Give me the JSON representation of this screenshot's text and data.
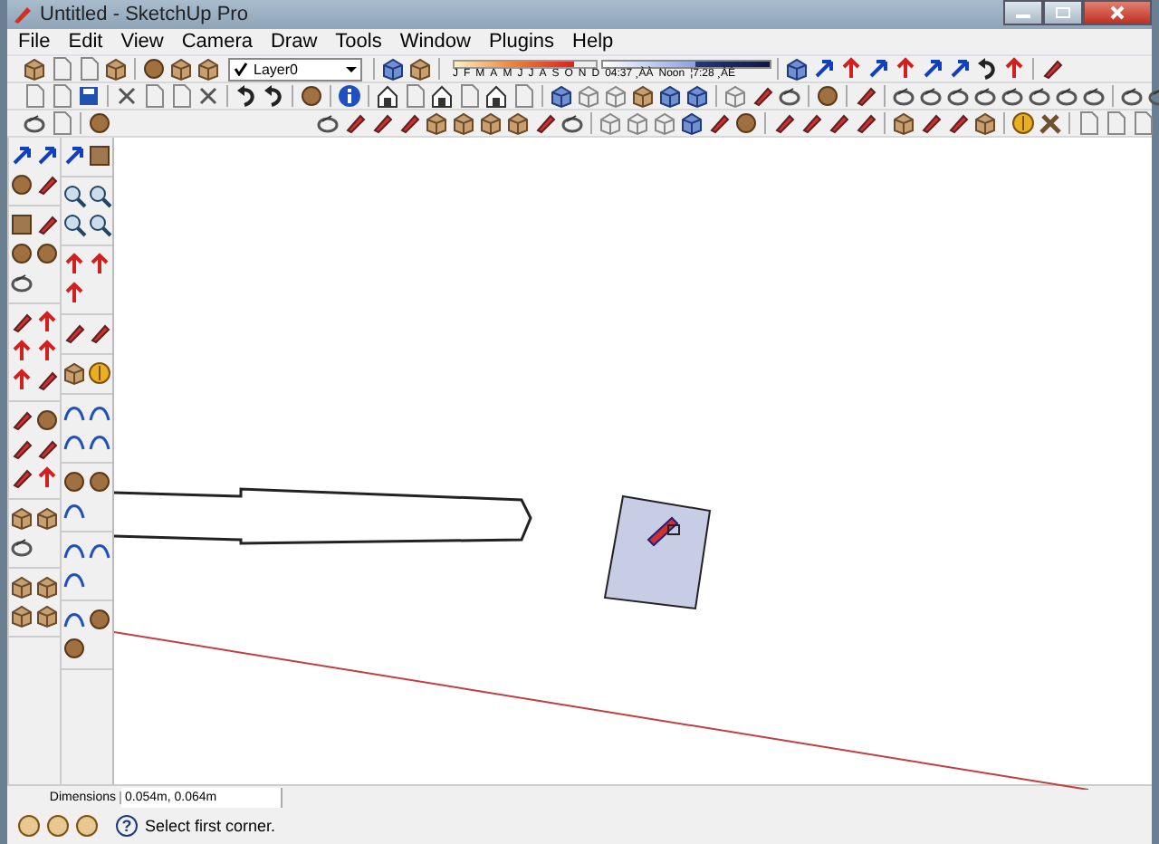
{
  "window": {
    "title": "Untitled - SketchUp Pro"
  },
  "menu": [
    "File",
    "Edit",
    "View",
    "Camera",
    "Draw",
    "Tools",
    "Window",
    "Plugins",
    "Help"
  ],
  "layers": {
    "value": "Layer0",
    "checked": true
  },
  "shadows": {
    "date_slider": {
      "level": 0.85
    },
    "time_slider": {
      "level": 0.55
    },
    "months": [
      "J",
      "F",
      "M",
      "A",
      "M",
      "J",
      "J",
      "A",
      "S",
      "O",
      "N",
      "D"
    ],
    "start_time": "04:37 ¸ÀÀ",
    "noon": "Noon",
    "end_time": "¦7:28 ¸ÀÈ"
  },
  "status_bar": {
    "measurement_label": "Dimensions",
    "measurement_value": "0.054m, 0.064m",
    "help_mark": "?",
    "message": "Select first corner."
  }
}
